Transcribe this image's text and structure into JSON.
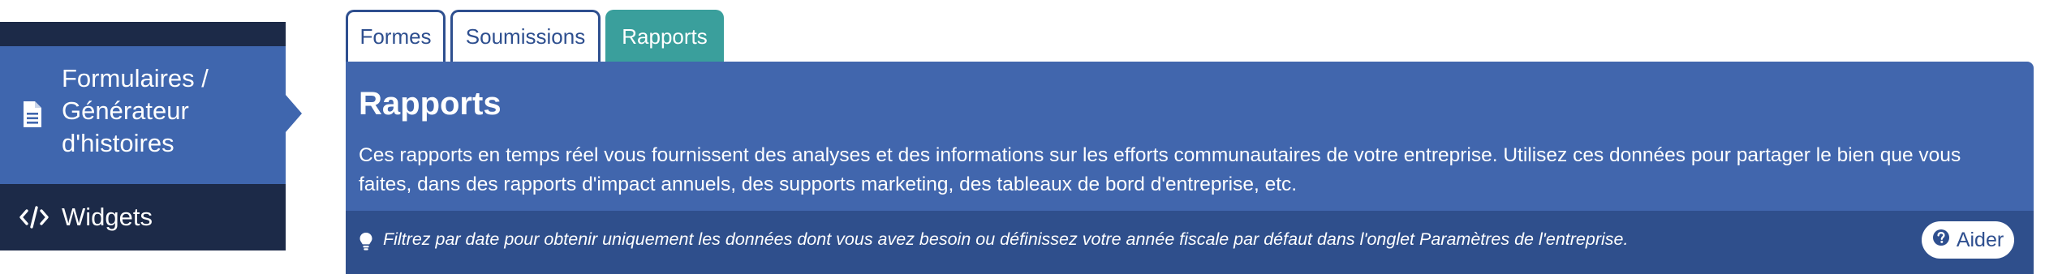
{
  "sidebar": {
    "items": [
      {
        "label_lines": [
          "Formulaires /",
          "Générateur",
          "d'histoires"
        ],
        "icon": "document-icon",
        "active": true
      },
      {
        "label": "Widgets",
        "icon": "code-icon",
        "active": false
      }
    ]
  },
  "tabs": [
    {
      "label": "Formes",
      "active": false
    },
    {
      "label": "Soumissions",
      "active": false
    },
    {
      "label": "Rapports",
      "active": true
    }
  ],
  "panel": {
    "title": "Rapports",
    "description": "Ces rapports en temps réel vous fournissent des analyses et des informations sur les efforts communautaires de votre entreprise. Utilisez ces données pour partager le bien que vous faites, dans des rapports d'impact annuels, des supports marketing, des tableaux de bord d'entreprise, etc.",
    "tip": "Filtrez par date pour obtenir uniquement les données dont vous avez besoin ou définissez votre année fiscale par défaut dans l'onglet Paramètres de l'entreprise.",
    "help_label": "Aider",
    "tip_icon": "lightbulb-icon",
    "help_icon": "question-circle-icon"
  },
  "colors": {
    "sidebar_dark": "#1c2a48",
    "sidebar_active": "#3f66ae",
    "tab_active": "#3a9f9c",
    "panel": "#4166ad",
    "panel_footer": "#2f4f8c"
  }
}
